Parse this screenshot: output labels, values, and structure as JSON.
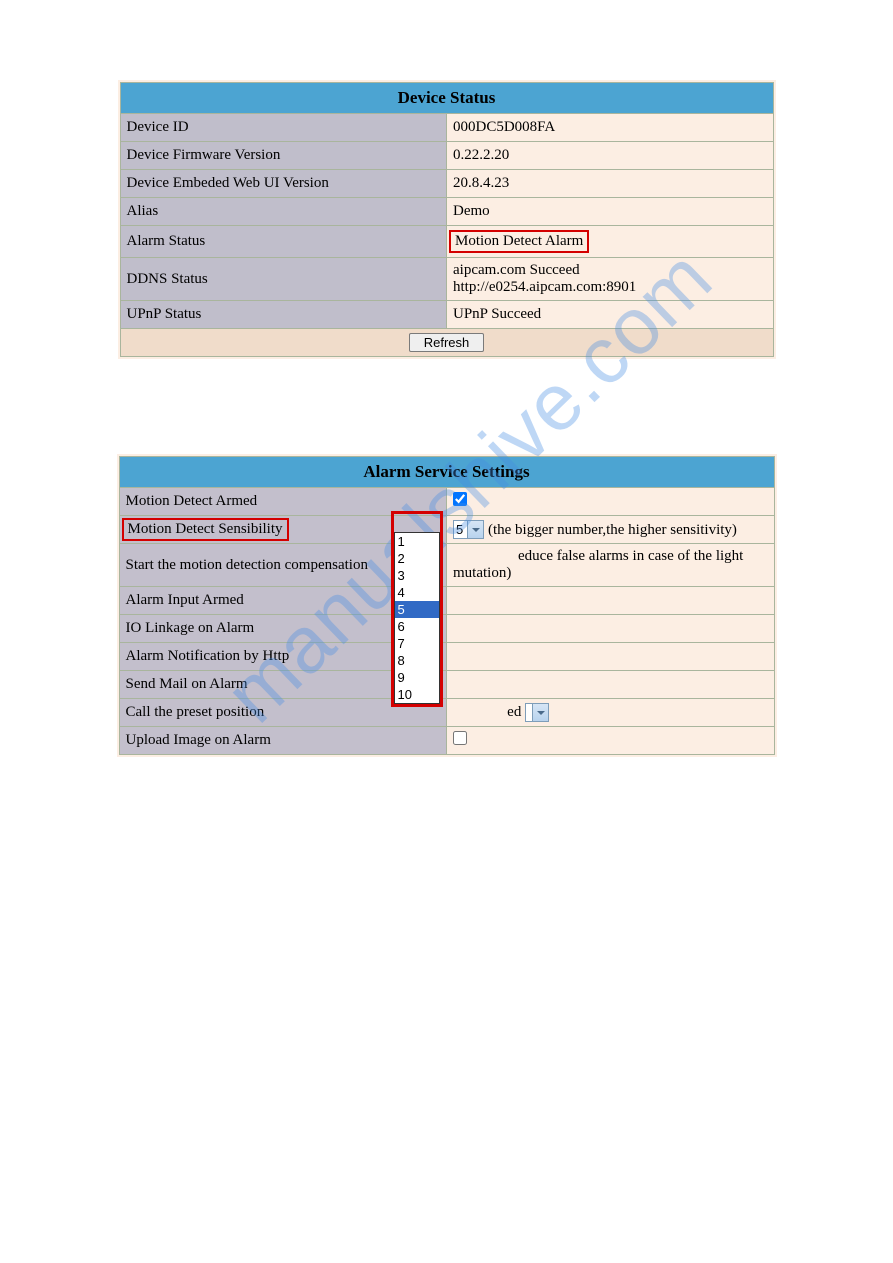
{
  "watermark": "manualshive.com",
  "device_status": {
    "header": "Device Status",
    "rows": {
      "device_id": {
        "label": "Device ID",
        "value": "000DC5D008FA"
      },
      "fw": {
        "label": "Device Firmware Version",
        "value": "0.22.2.20"
      },
      "webui": {
        "label": "Device Embeded Web UI Version",
        "value": "20.8.4.23"
      },
      "alias": {
        "label": "Alias",
        "value": "Demo"
      },
      "alarm": {
        "label": "Alarm Status",
        "value": "Motion Detect Alarm"
      },
      "ddns": {
        "label": "DDNS Status",
        "value": "aipcam.com  Succeed  http://e0254.aipcam.com:8901"
      },
      "upnp": {
        "label": "UPnP Status",
        "value": "UPnP Succeed"
      }
    },
    "refresh_label": "Refresh"
  },
  "alarm_settings": {
    "header": "Alarm Service Settings",
    "rows": {
      "armed": {
        "label": "Motion Detect Armed"
      },
      "sensibility": {
        "label": "Motion Detect Sensibility",
        "value": "5",
        "hint": "(the bigger number,the higher sensitivity)"
      },
      "compensation": {
        "label": "Start the motion detection compensation",
        "hint_tail": "educe false alarms in case of the light mutation)"
      },
      "input_armed": {
        "label": "Alarm Input Armed"
      },
      "io_linkage": {
        "label": "IO Linkage on Alarm"
      },
      "http_notify": {
        "label": "Alarm Notification by Http"
      },
      "send_mail": {
        "label": "Send Mail on Alarm"
      },
      "preset": {
        "label": "Call the preset position",
        "value_tail": "ed"
      },
      "upload": {
        "label": "Upload Image on Alarm"
      }
    },
    "dropdown": {
      "options": [
        "1",
        "2",
        "3",
        "4",
        "5",
        "6",
        "7",
        "8",
        "9",
        "10"
      ],
      "selected": "5"
    }
  }
}
